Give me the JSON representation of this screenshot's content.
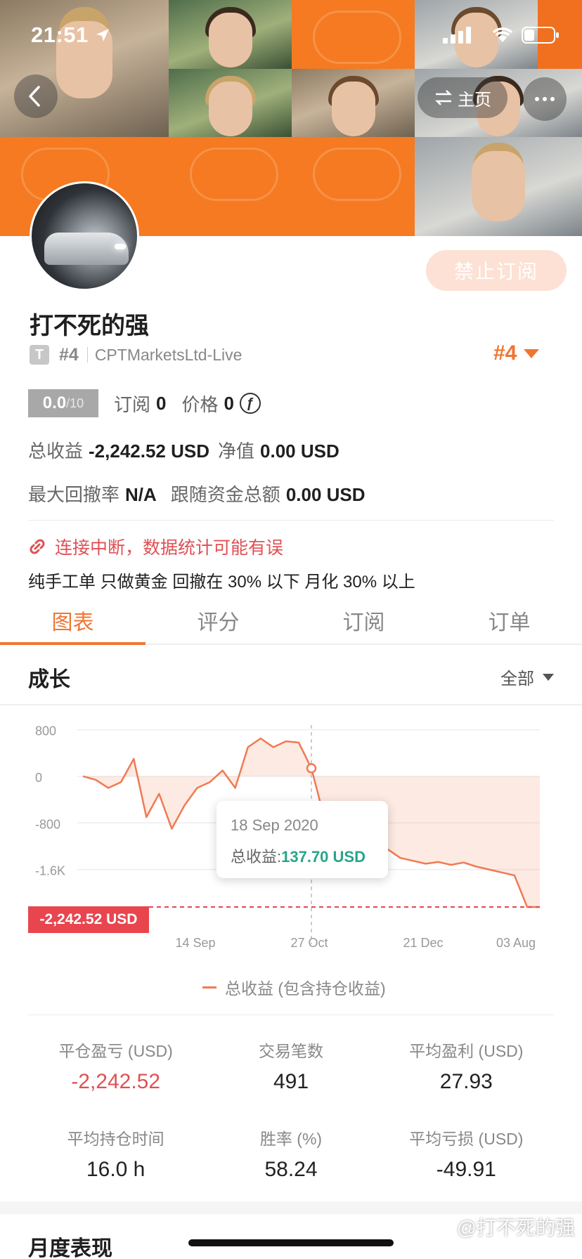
{
  "status_bar": {
    "time": "21:51"
  },
  "header": {
    "home_label": "主页",
    "ban_label": "禁止订阅"
  },
  "profile": {
    "name": "打不死的强",
    "badge": "T",
    "rank_small": "#4",
    "broker": "CPTMarketsLtd-Live",
    "rank_big": "#4",
    "score": "0.0",
    "score_max": "/10",
    "subs_label": "订阅",
    "subs_value": "0",
    "price_label": "价格",
    "price_value": "0",
    "total_profit_label": "总收益",
    "total_profit_value": "-2,242.52 USD",
    "net_label": "净值",
    "net_value": "0.00 USD",
    "max_dd_label": "最大回撤率",
    "max_dd_value": "N/A",
    "follow_label": "跟随资金总额",
    "follow_value": "0.00 USD",
    "warning": "连接中断，数据统计可能有误",
    "description": "纯手工单 只做黄金 回撤在 30% 以下 月化 30% 以上"
  },
  "tabs": [
    "图表",
    "评分",
    "订阅",
    "订单"
  ],
  "section": {
    "title": "成长",
    "filter": "全部"
  },
  "chart_data": {
    "type": "area",
    "y_ticks": [
      "800",
      "0",
      "-800",
      "-1.6K"
    ],
    "y_tick_values": [
      800,
      0,
      -800,
      -1600
    ],
    "x_ticks": [
      "14 Sep",
      "27 Oct",
      "21 Dec",
      "03 Aug"
    ],
    "series": [
      {
        "name": "总收益 (包含持仓收益)",
        "values": [
          0,
          -60,
          -200,
          -100,
          300,
          -700,
          -300,
          -900,
          -500,
          -200,
          -100,
          100,
          -200,
          500,
          650,
          500,
          600,
          580,
          137.7,
          -700,
          -950,
          -1050,
          -1100,
          -1200,
          -1250,
          -1400,
          -1450,
          -1500,
          -1470,
          -1520,
          -1480,
          -1550,
          -1600,
          -1650,
          -1700,
          -2242.52,
          -2242.52
        ]
      }
    ],
    "ylim": [
      -2400,
      1000
    ],
    "current_value_label": "-2,242.52 USD",
    "tooltip": {
      "date": "18 Sep 2020",
      "label": "总收益:",
      "value": "137.70 USD"
    },
    "line_color": "#f07a52",
    "current_color": "#e8454f"
  },
  "metrics": [
    {
      "label": "平仓盈亏 (USD)",
      "value": "-2,242.52",
      "negative": true
    },
    {
      "label": "交易笔数",
      "value": "491"
    },
    {
      "label": "平均盈利 (USD)",
      "value": "27.93"
    },
    {
      "label": "平均持仓时间",
      "value": "16.0 h"
    },
    {
      "label": "胜率 (%)",
      "value": "58.24"
    },
    {
      "label": "平均亏损 (USD)",
      "value": "-49.91"
    }
  ],
  "monthly_title": "月度表现",
  "watermark": "@打不死的强",
  "colors": {
    "accent": "#f07532",
    "negative": "#e05055",
    "positive": "#27a58a"
  }
}
